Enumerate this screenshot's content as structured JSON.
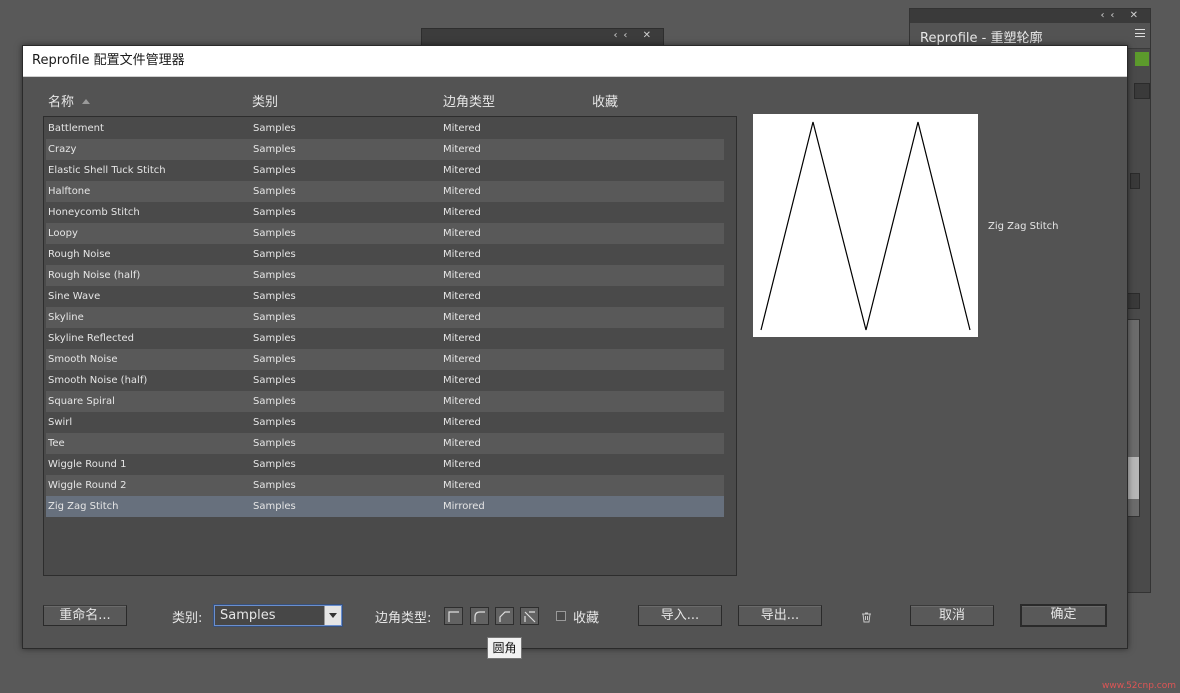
{
  "window": {
    "title": "Reprofile 配置文件管理器"
  },
  "background_panel": {
    "title": "Reprofile - 重塑轮廓",
    "collapse_icon": "double-chevron-left",
    "close_icon": "x"
  },
  "table": {
    "headers": {
      "name": "名称",
      "category": "类别",
      "corner": "边角类型",
      "favorite": "收藏"
    },
    "rows": [
      {
        "name": "Battlement",
        "category": "Samples",
        "corner": "Mitered"
      },
      {
        "name": "Crazy",
        "category": "Samples",
        "corner": "Mitered"
      },
      {
        "name": "Elastic Shell Tuck Stitch",
        "category": "Samples",
        "corner": "Mitered"
      },
      {
        "name": "Halftone",
        "category": "Samples",
        "corner": "Mitered"
      },
      {
        "name": "Honeycomb Stitch",
        "category": "Samples",
        "corner": "Mitered"
      },
      {
        "name": "Loopy",
        "category": "Samples",
        "corner": "Mitered"
      },
      {
        "name": "Rough Noise",
        "category": "Samples",
        "corner": "Mitered"
      },
      {
        "name": "Rough Noise (half)",
        "category": "Samples",
        "corner": "Mitered"
      },
      {
        "name": "Sine Wave",
        "category": "Samples",
        "corner": "Mitered"
      },
      {
        "name": "Skyline",
        "category": "Samples",
        "corner": "Mitered"
      },
      {
        "name": "Skyline Reflected",
        "category": "Samples",
        "corner": "Mitered"
      },
      {
        "name": "Smooth Noise",
        "category": "Samples",
        "corner": "Mitered"
      },
      {
        "name": "Smooth Noise (half)",
        "category": "Samples",
        "corner": "Mitered"
      },
      {
        "name": "Square Spiral",
        "category": "Samples",
        "corner": "Mitered"
      },
      {
        "name": "Swirl",
        "category": "Samples",
        "corner": "Mitered"
      },
      {
        "name": "Tee",
        "category": "Samples",
        "corner": "Mitered"
      },
      {
        "name": "Wiggle Round 1",
        "category": "Samples",
        "corner": "Mitered"
      },
      {
        "name": "Wiggle Round 2",
        "category": "Samples",
        "corner": "Mitered"
      },
      {
        "name": "Zig Zag Stitch",
        "category": "Samples",
        "corner": "Mirrored"
      }
    ],
    "selected_index": 18
  },
  "preview": {
    "label": "Zig Zag Stitch"
  },
  "footer": {
    "rename_label": "重命名...",
    "category_label": "类别:",
    "category_value": "Samples",
    "corner_label": "边角类型:",
    "favorite_label": "收藏",
    "import_label": "导入...",
    "export_label": "导出...",
    "cancel_label": "取消",
    "ok_label": "确定"
  },
  "tooltip": {
    "text": "圆角"
  },
  "watermark": {
    "text": "www.52cnp.com"
  },
  "colors": {
    "selected_row": "#67707d",
    "dialog_bg": "#535353",
    "accent_green": "#5c9a2c"
  }
}
